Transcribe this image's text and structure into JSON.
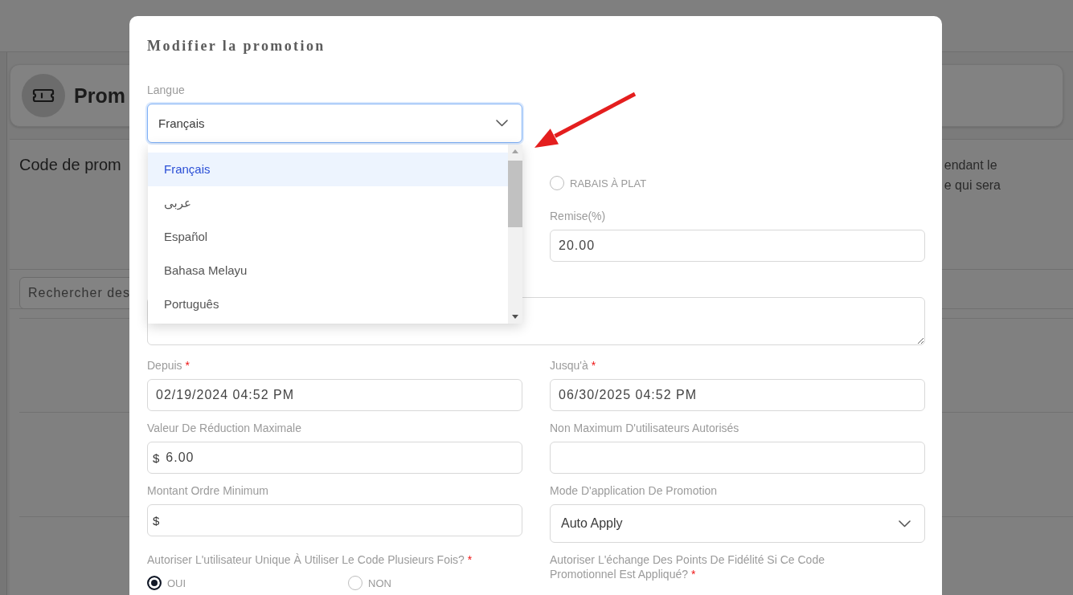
{
  "background": {
    "page_header": {
      "title": "Prom"
    },
    "section": {
      "heading": "Code de prom",
      "description_lines": [
        "endant le",
        "e qui sera"
      ]
    },
    "search": {
      "placeholder": "Rechercher des"
    }
  },
  "modal": {
    "title": "Modifier la promotion",
    "language": {
      "label": "Langue",
      "value": "Français",
      "expanded": true,
      "options": [
        {
          "label": "Français",
          "selected": true
        },
        {
          "label": "عربى",
          "selected": false
        },
        {
          "label": "Español",
          "selected": false
        },
        {
          "label": "Bahasa Melayu",
          "selected": false
        },
        {
          "label": "Português",
          "selected": false
        }
      ]
    },
    "form_rows": [
      {
        "right": {
          "kind": "radio_group",
          "options": [
            {
              "label": "RABAIS À PLAT",
              "selected": false
            }
          ]
        }
      },
      {
        "right": {
          "kind": "input",
          "label": "Remise(%)",
          "value": "20.00"
        }
      },
      {
        "full": {
          "kind": "textarea"
        }
      },
      {
        "left": {
          "kind": "input",
          "label": "Depuis",
          "required_mark": "*",
          "value": "02/19/2024 04:52 PM"
        },
        "right": {
          "kind": "input",
          "label": "Jusqu'à",
          "required_mark": "*",
          "value": "06/30/2025 04:52 PM"
        }
      },
      {
        "left": {
          "kind": "input",
          "label": "Valeur De Réduction Maximale",
          "prefix": "$",
          "value": "6.00"
        },
        "right": {
          "kind": "input",
          "label": "Non Maximum D'utilisateurs Autorisés"
        }
      },
      {
        "left": {
          "kind": "input",
          "label": "Montant Ordre Minimum",
          "prefix": "$"
        },
        "right": {
          "kind": "select",
          "label": "Mode D'application De Promotion",
          "value": "Auto Apply"
        }
      },
      {
        "left": {
          "kind": "radio_group",
          "label": "Autoriser L'utilisateur Unique À Utiliser Le Code Plusieurs Fois?",
          "required_mark": "*",
          "options": [
            {
              "label": "OUI",
              "selected": true
            },
            {
              "label": "NON",
              "selected": false
            }
          ]
        },
        "right": {
          "kind": "label",
          "label": "Autoriser L'échange Des Points De Fidélité Si Ce Code Promotionnel Est Appliqué?",
          "required_mark": "*"
        }
      }
    ]
  }
}
